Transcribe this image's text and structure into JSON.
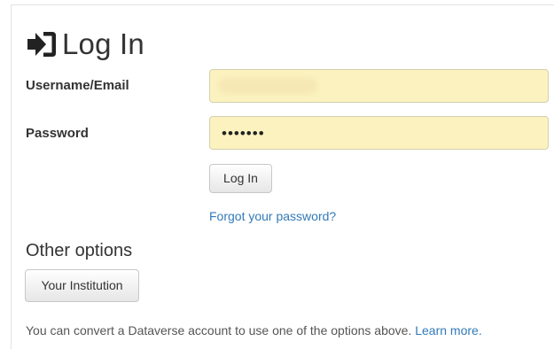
{
  "page": {
    "title": "Log In",
    "icon": "sign-in-icon"
  },
  "form": {
    "username_label": "Username/Email",
    "username_value": "",
    "password_label": "Password",
    "password_mask": "•••••••",
    "login_button": "Log In",
    "forgot_link": "Forgot your password?"
  },
  "other_options": {
    "heading": "Other options",
    "institution_button": "Your Institution",
    "convert_text": "You can convert a Dataverse account to use one of the options above.",
    "learn_more": "Learn more."
  },
  "colors": {
    "input_autofill_bg": "#fbf2bf",
    "link": "#337ab7",
    "text": "#333333"
  }
}
